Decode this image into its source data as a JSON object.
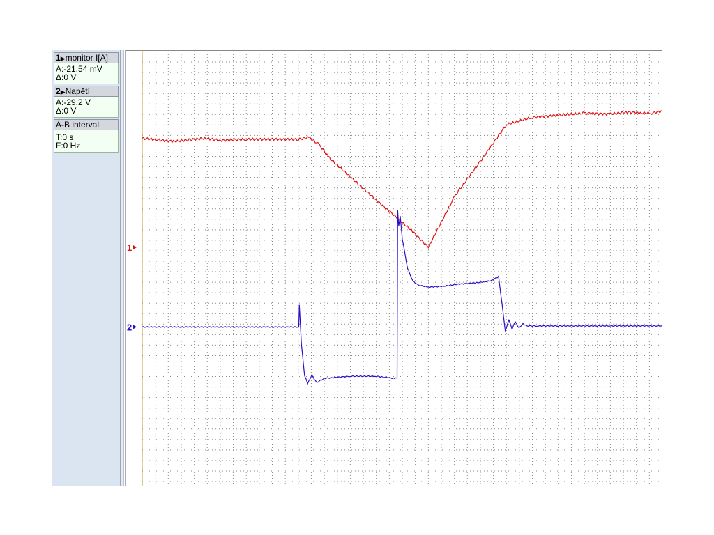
{
  "sidebar": {
    "channels": [
      {
        "number": "1",
        "name": "monitor I[A]",
        "line1": "A:-21.54 mV",
        "line2": "Δ:0 V"
      },
      {
        "number": "2",
        "name": "Napětí",
        "line1": "A:-29.2 V",
        "line2": "Δ:0 V"
      }
    ],
    "interval": {
      "title": "A-B interval",
      "line1": "T:0 s",
      "line2": "F:0 Hz"
    }
  },
  "markers": {
    "ch1": "1",
    "ch2": "2"
  },
  "colors": {
    "ch1": "#dd1111",
    "ch2": "#2a0fc8",
    "grid_dot": "#8a8a8a",
    "cursor": "#b8a040"
  },
  "chart_data": {
    "type": "line",
    "title": "",
    "xlabel": "",
    "ylabel": "",
    "grid": true,
    "grid_divisions": {
      "x": 40,
      "y": 33
    },
    "series": [
      {
        "channel": "1",
        "x_div": [
          0,
          6,
          12,
          15,
          20,
          30,
          32,
          34,
          36,
          45,
          49,
          52,
          55,
          60,
          61,
          65,
          70,
          75,
          80,
          85,
          90,
          93,
          96,
          98,
          100
        ],
        "y_div": [
          10.4,
          10.1,
          10.4,
          10.2,
          10.3,
          10.3,
          10.5,
          9.8,
          8.5,
          4.5,
          2.8,
          1.5,
          0.0,
          4.8,
          5.5,
          8.2,
          11.7,
          12.4,
          12.6,
          12.8,
          12.7,
          12.9,
          12.8,
          12.8,
          13.0
        ]
      },
      {
        "channel": "2",
        "x_div": [
          0,
          30,
          30.1,
          30.2,
          30.6,
          31.2,
          31.8,
          32.6,
          33.5,
          35,
          40,
          45,
          48.5,
          49,
          49.1,
          49.3,
          49.6,
          50,
          51,
          52,
          53,
          55,
          58,
          61,
          64,
          67,
          68.5,
          69.2,
          69.8,
          70.5,
          71.1,
          71.7,
          72.4,
          73.2,
          74,
          76,
          80,
          90,
          100
        ],
        "y_div": [
          -7.6,
          -7.6,
          -7.6,
          -5.5,
          -9.2,
          -12.2,
          -13.0,
          -12.2,
          -12.9,
          -12.5,
          -12.3,
          -12.3,
          -12.5,
          -12.5,
          3.5,
          2.0,
          3.0,
          0.8,
          -2.0,
          -3.2,
          -3.6,
          -3.8,
          -3.7,
          -3.5,
          -3.4,
          -3.2,
          -2.8,
          -5.5,
          -8.0,
          -6.9,
          -7.8,
          -7.1,
          -7.7,
          -7.3,
          -7.5,
          -7.5,
          -7.5,
          -7.5,
          -7.5
        ]
      }
    ],
    "cursor_x_div": 0,
    "ch1_marker_y_div": 0,
    "ch2_marker_y_div": -7.6
  }
}
